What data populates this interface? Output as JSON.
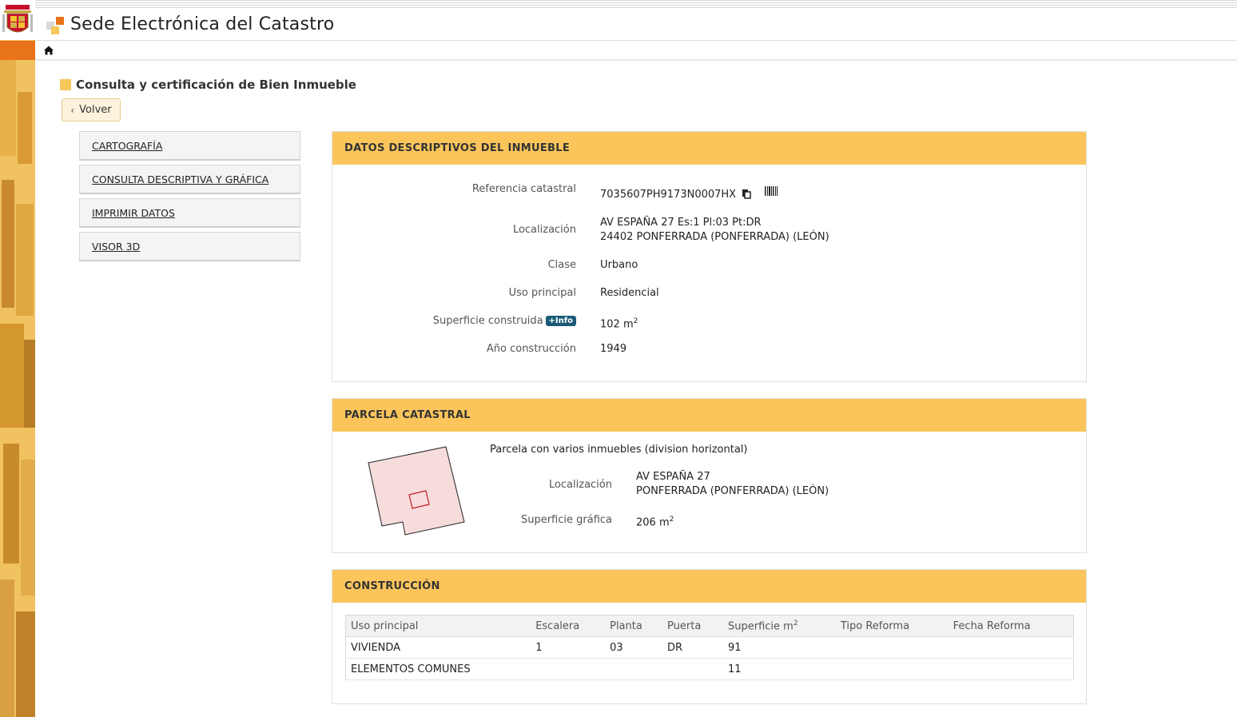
{
  "header": {
    "title": "Sede Electrónica del Catastro"
  },
  "page": {
    "title": "Consulta y certificación de Bien Inmueble",
    "back_label": "Volver"
  },
  "side_menu": [
    {
      "label": "CARTOGRAFÍA"
    },
    {
      "label": "CONSULTA DESCRIPTIVA Y GRÁFICA"
    },
    {
      "label": "IMPRIMIR DATOS"
    },
    {
      "label": "VISOR 3D"
    }
  ],
  "datos": {
    "heading": "DATOS DESCRIPTIVOS DEL INMUEBLE",
    "ref_label": "Referencia catastral",
    "ref_value": "7035607PH9173N0007HX",
    "loc_label": "Localización",
    "loc_line1": "AV ESPAÑA 27 Es:1 Pl:03 Pt:DR",
    "loc_line2": "24402 PONFERRADA (PONFERRADA) (LEÓN)",
    "clase_label": "Clase",
    "clase_value": "Urbano",
    "uso_label": "Uso principal",
    "uso_value": "Residencial",
    "sup_label": "Superficie construida",
    "info_badge": "+Info",
    "sup_value": "102 m",
    "sup_unit_exp": "2",
    "anio_label": "Año construcción",
    "anio_value": "1949"
  },
  "parcela": {
    "heading": "PARCELA CATASTRAL",
    "desc": "Parcela con varios inmuebles (division horizontal)",
    "loc_label": "Localización",
    "loc_line1": "AV ESPAÑA 27",
    "loc_line2": "PONFERRADA (PONFERRADA) (LEÓN)",
    "sup_label": "Superficie gráfica",
    "sup_value": "206 m",
    "sup_unit_exp": "2"
  },
  "construccion": {
    "heading": "CONSTRUCCIÓN",
    "columns": [
      "Uso principal",
      "Escalera",
      "Planta",
      "Puerta",
      "Superficie m",
      "Tipo Reforma",
      "Fecha Reforma"
    ],
    "sup_col_exp": "2",
    "rows": [
      [
        "VIVIENDA",
        "1",
        "03",
        "DR",
        "91",
        "",
        ""
      ],
      [
        "ELEMENTOS COMUNES",
        "",
        "",
        "",
        "11",
        "",
        ""
      ]
    ]
  },
  "icons": {
    "copy": "copy-icon",
    "barcode": "barcode-icon",
    "home": "home-icon",
    "brand": "catastro-logo-icon",
    "coat_of_arms": "coat-of-arms-icon"
  },
  "colors": {
    "accent": "#fbc55c",
    "orange": "#e8731a",
    "badge": "#1b5b78"
  }
}
